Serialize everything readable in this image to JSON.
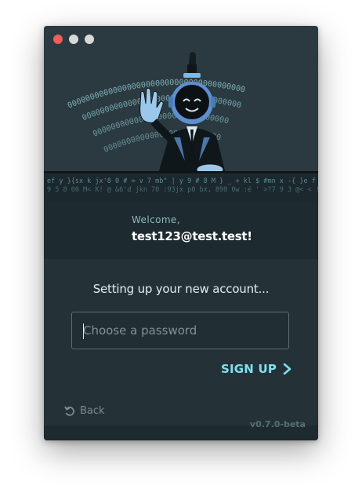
{
  "window": {
    "controls": [
      "close",
      "minimize",
      "maximize"
    ]
  },
  "hero": {
    "illustration": "robot-mascot-waving",
    "binary_arc_text": "0000000000000000",
    "code_lines": [
      "ef y }{sx k jx'8 0 # = v 7 mb\" | y 9 # 8 M } _ + kl $ #mn x -{ }e f {]> 1 82",
      "9 5 8 00 M< K! @ &6'd jkn 70 :93jx p0 bx, 890 0w :é ' >?7 9 3 @< < !2 3"
    ]
  },
  "welcome": {
    "label": "Welcome,",
    "email": "test123@test.test!"
  },
  "setup": {
    "message": "Setting up your new account..."
  },
  "password": {
    "value": "",
    "placeholder": "Choose a password"
  },
  "actions": {
    "signup_label": "SIGN UP",
    "back_label": "Back"
  },
  "footer": {
    "version": "v0.7.0-beta"
  },
  "colors": {
    "accent": "#7fe0ee",
    "background": "#243238",
    "close_dot": "#ed5f57"
  },
  "icons": {
    "signup": "chevron-right-icon",
    "back": "undo-icon"
  }
}
